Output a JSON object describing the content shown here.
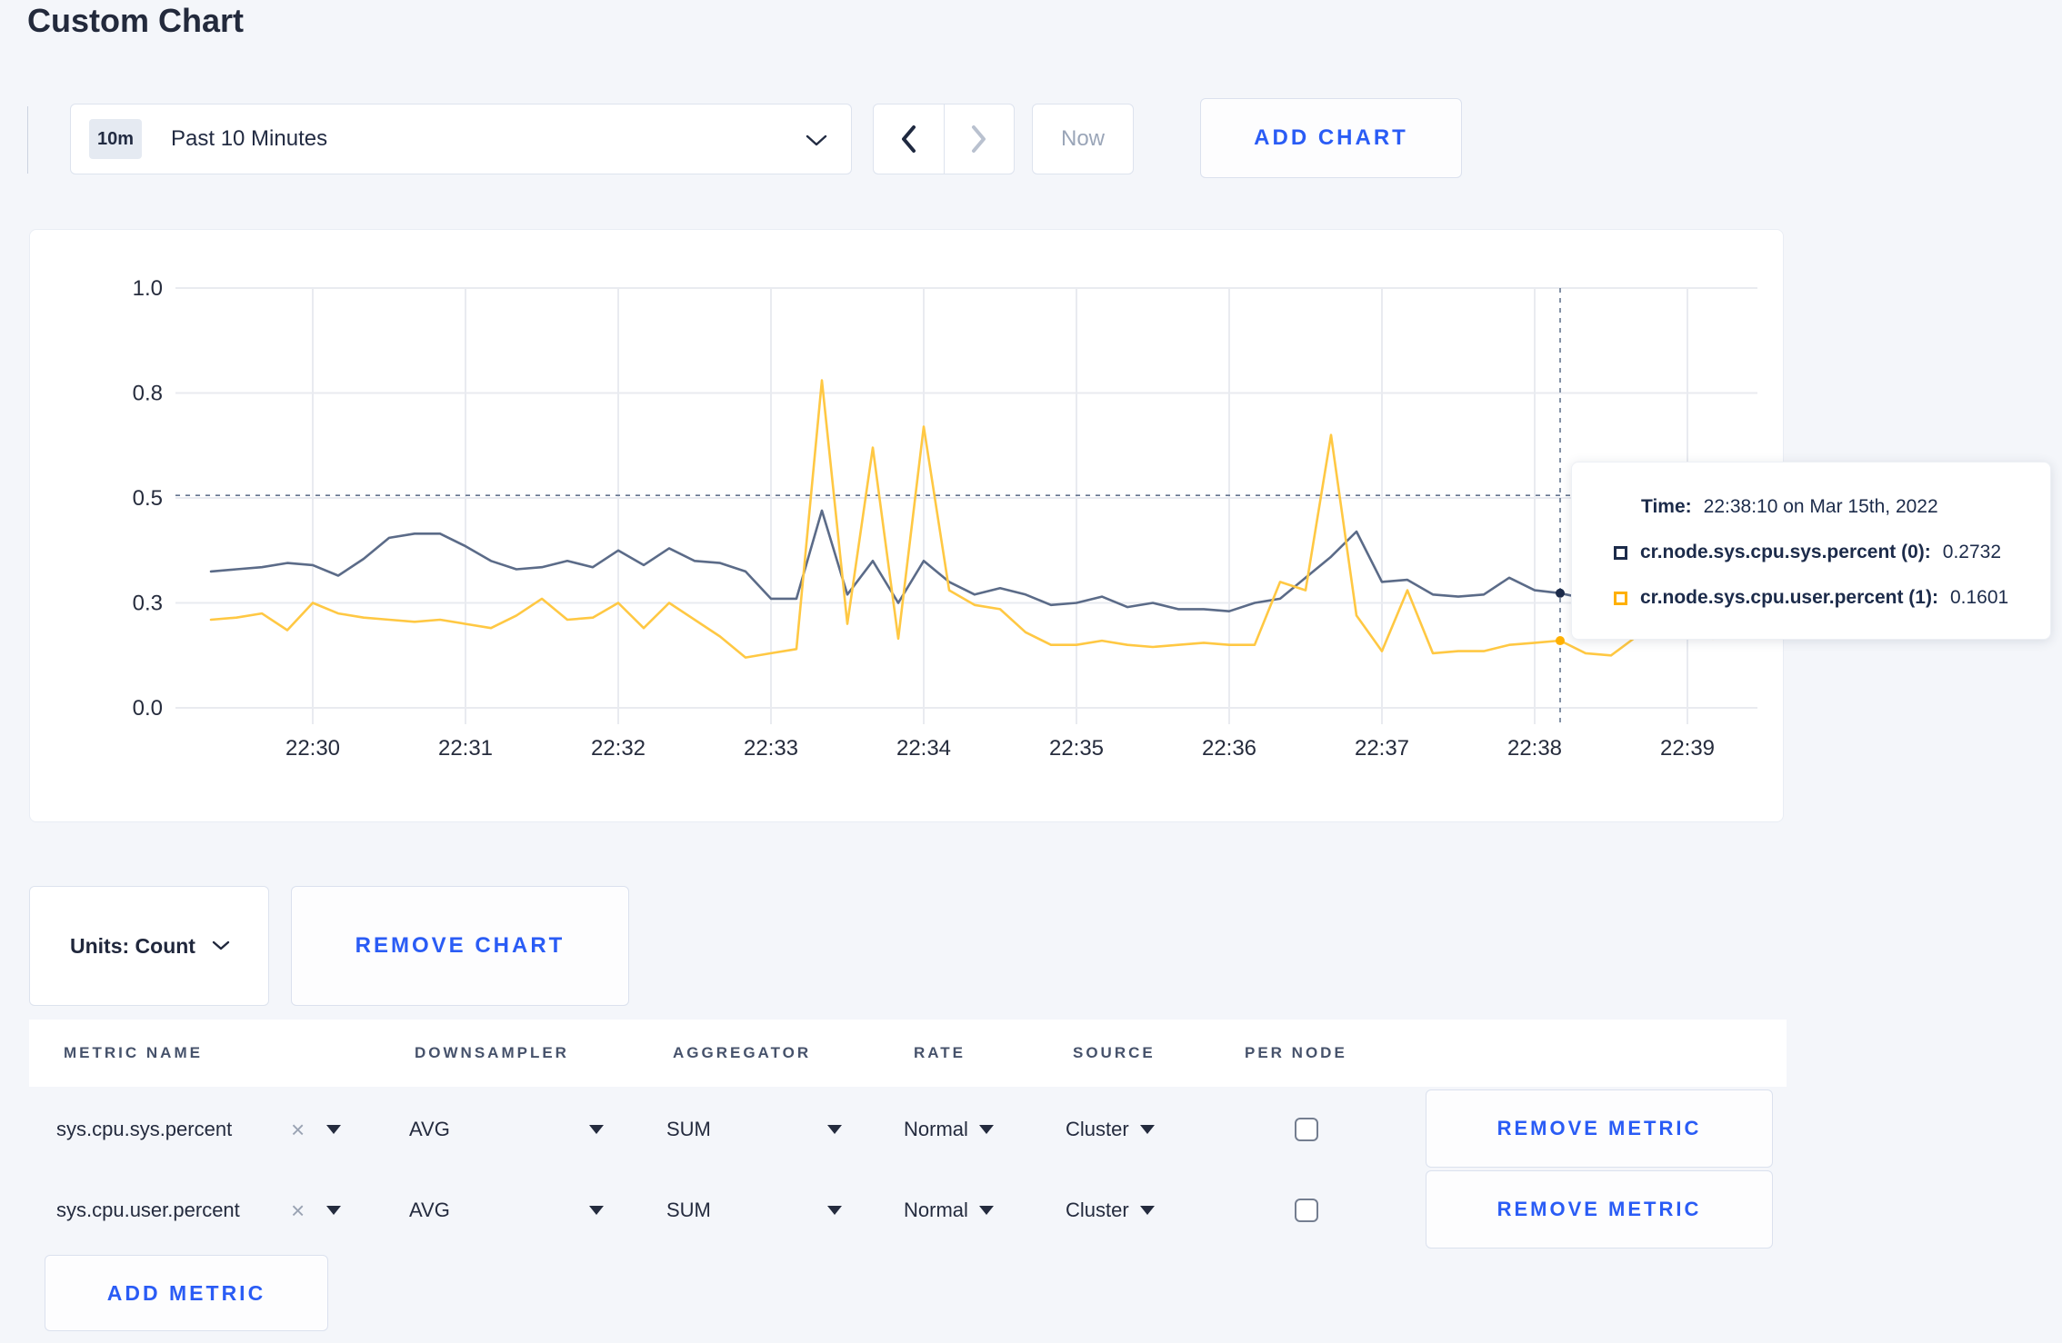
{
  "page": {
    "title": "Custom Chart"
  },
  "toolbar": {
    "range_badge": "10m",
    "range_label": "Past 10 Minutes",
    "now_label": "Now",
    "add_chart_label": "ADD CHART"
  },
  "icons": {
    "range_chevron": "chevron-down",
    "prev": "chevron-left",
    "next": "chevron-right",
    "units_chevron": "chevron-down",
    "clear_glyph": "×",
    "select_caret": "triangle-down"
  },
  "colors": {
    "accent_blue": "#2a5cf5",
    "page_bg": "#f4f6fa",
    "grid": "#e9ebf0",
    "axis_text": "#262c3d",
    "crosshair": "#64748f"
  },
  "chart_data": {
    "type": "line",
    "title": "",
    "xlabel": "",
    "ylabel": "",
    "ylim": [
      0,
      1
    ],
    "grid": true,
    "yticks": [
      {
        "v": 0.0,
        "label": "0.0"
      },
      {
        "v": 0.25,
        "label": "0.3"
      },
      {
        "v": 0.5,
        "label": "0.5"
      },
      {
        "v": 0.75,
        "label": "0.8"
      },
      {
        "v": 1.0,
        "label": "1.0"
      }
    ],
    "xticks": [
      "22:30",
      "22:31",
      "22:32",
      "22:33",
      "22:34",
      "22:35",
      "22:36",
      "22:37",
      "22:38",
      "22:39"
    ],
    "x": [
      "22:29:20",
      "22:29:30",
      "22:29:40",
      "22:29:50",
      "22:30:00",
      "22:30:10",
      "22:30:20",
      "22:30:30",
      "22:30:40",
      "22:30:50",
      "22:31:00",
      "22:31:10",
      "22:31:20",
      "22:31:30",
      "22:31:40",
      "22:31:50",
      "22:32:00",
      "22:32:10",
      "22:32:20",
      "22:32:30",
      "22:32:40",
      "22:32:50",
      "22:33:00",
      "22:33:10",
      "22:33:20",
      "22:33:30",
      "22:33:40",
      "22:33:50",
      "22:34:00",
      "22:34:10",
      "22:34:20",
      "22:34:30",
      "22:34:40",
      "22:34:50",
      "22:35:00",
      "22:35:10",
      "22:35:20",
      "22:35:30",
      "22:35:40",
      "22:35:50",
      "22:36:00",
      "22:36:10",
      "22:36:20",
      "22:36:30",
      "22:36:40",
      "22:36:50",
      "22:37:00",
      "22:37:10",
      "22:37:20",
      "22:37:30",
      "22:37:40",
      "22:37:50",
      "22:38:00",
      "22:38:10",
      "22:38:20",
      "22:38:30",
      "22:38:40",
      "22:38:50",
      "22:39:00",
      "22:39:10"
    ],
    "series": [
      {
        "name": "cr.node.sys.cpu.sys.percent (0)",
        "line_color": "#5b6b88",
        "swatch_color": "#1c2b4a",
        "values": [
          0.325,
          0.33,
          0.335,
          0.345,
          0.34,
          0.315,
          0.355,
          0.405,
          0.415,
          0.415,
          0.385,
          0.35,
          0.33,
          0.335,
          0.35,
          0.335,
          0.375,
          0.34,
          0.38,
          0.35,
          0.345,
          0.325,
          0.26,
          0.26,
          0.47,
          0.27,
          0.35,
          0.25,
          0.35,
          0.3,
          0.27,
          0.285,
          0.27,
          0.245,
          0.25,
          0.265,
          0.24,
          0.25,
          0.235,
          0.235,
          0.23,
          0.25,
          0.26,
          0.31,
          0.36,
          0.42,
          0.3,
          0.305,
          0.27,
          0.265,
          0.27,
          0.31,
          0.28,
          0.2732,
          0.26,
          0.27,
          0.29,
          0.3,
          0.295,
          0.3
        ]
      },
      {
        "name": "cr.node.sys.cpu.user.percent (1)",
        "line_color": "#ffc843",
        "swatch_color": "#ffb000",
        "values": [
          0.21,
          0.215,
          0.225,
          0.185,
          0.25,
          0.225,
          0.215,
          0.21,
          0.205,
          0.21,
          0.2,
          0.19,
          0.22,
          0.26,
          0.21,
          0.215,
          0.25,
          0.19,
          0.25,
          0.21,
          0.17,
          0.12,
          0.13,
          0.14,
          0.78,
          0.2,
          0.62,
          0.165,
          0.67,
          0.28,
          0.245,
          0.235,
          0.18,
          0.15,
          0.15,
          0.16,
          0.15,
          0.145,
          0.15,
          0.155,
          0.15,
          0.15,
          0.3,
          0.28,
          0.65,
          0.22,
          0.135,
          0.28,
          0.13,
          0.135,
          0.135,
          0.15,
          0.155,
          0.1601,
          0.13,
          0.125,
          0.17,
          0.21,
          0.205,
          0.165
        ]
      }
    ],
    "crosshair": {
      "x_index": 53,
      "y_value": 0.506
    }
  },
  "tooltip": {
    "time_label": "Time:",
    "time_value": "22:38:10 on Mar 15th, 2022",
    "entries": [
      {
        "name": "cr.node.sys.cpu.sys.percent (0):",
        "value": "0.2732"
      },
      {
        "name": "cr.node.sys.cpu.user.percent (1):",
        "value": "0.1601"
      }
    ]
  },
  "units_bar": {
    "units_label": "Units: Count",
    "remove_chart_label": "REMOVE CHART"
  },
  "table": {
    "headers": [
      "METRIC NAME",
      "DOWNSAMPLER",
      "AGGREGATOR",
      "RATE",
      "SOURCE",
      "PER NODE"
    ],
    "rows": [
      {
        "metric": "sys.cpu.sys.percent",
        "downsampler": "AVG",
        "aggregator": "SUM",
        "rate": "Normal",
        "source": "Cluster",
        "per_node_checked": false,
        "remove_label": "REMOVE METRIC"
      },
      {
        "metric": "sys.cpu.user.percent",
        "downsampler": "AVG",
        "aggregator": "SUM",
        "rate": "Normal",
        "source": "Cluster",
        "per_node_checked": false,
        "remove_label": "REMOVE METRIC"
      }
    ],
    "add_metric_label": "ADD METRIC"
  }
}
